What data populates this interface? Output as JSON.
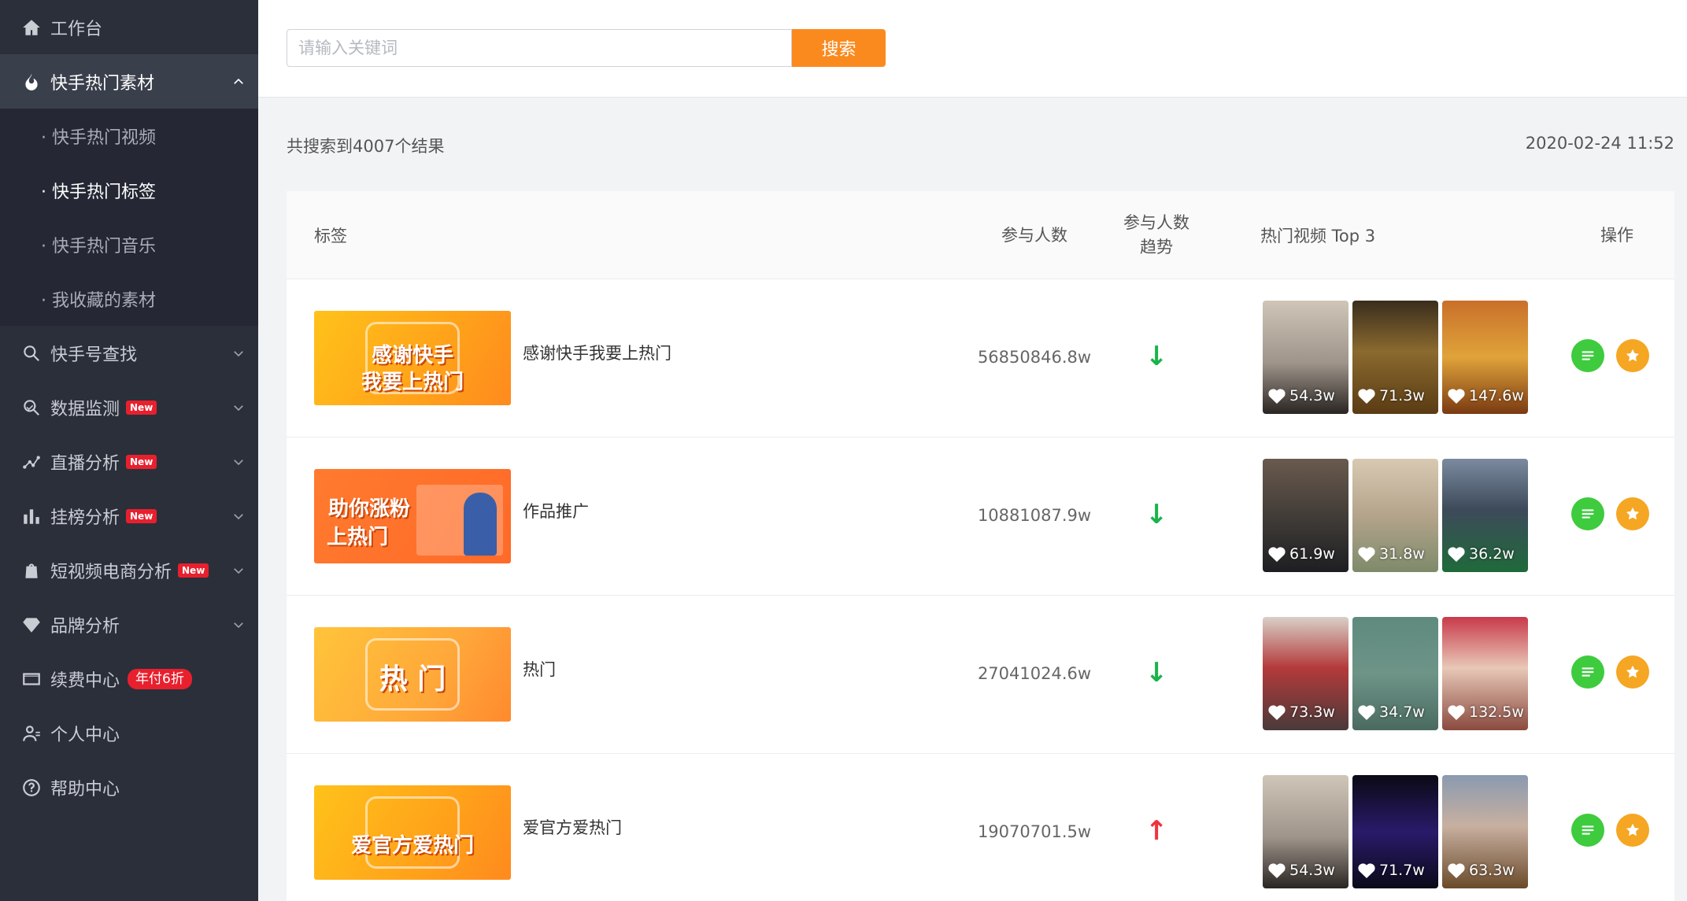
{
  "sidebar": {
    "items": [
      {
        "label": "工作台",
        "icon": "home-icon"
      },
      {
        "label": "快手热门素材",
        "icon": "fire-icon",
        "expanded": true,
        "children": [
          "· 快手热门视频",
          "· 快手热门标签",
          "· 快手热门音乐",
          "· 我收藏的素材"
        ],
        "current_child": 1
      },
      {
        "label": "快手号查找",
        "icon": "search-icon"
      },
      {
        "label": "数据监测",
        "icon": "monitor-icon",
        "badge": "New"
      },
      {
        "label": "直播分析",
        "icon": "live-chart-icon",
        "badge": "New"
      },
      {
        "label": "挂榜分析",
        "icon": "bar-chart-icon",
        "badge": "New"
      },
      {
        "label": "短视频电商分析",
        "icon": "shopping-bag-icon",
        "badge": "New"
      },
      {
        "label": "品牌分析",
        "icon": "diamond-icon"
      },
      {
        "label": "续费中心",
        "icon": "card-icon",
        "promo": "年付6折"
      },
      {
        "label": "个人中心",
        "icon": "user-icon"
      },
      {
        "label": "帮助中心",
        "icon": "help-icon"
      }
    ]
  },
  "search": {
    "placeholder": "请输入关键词",
    "value": "",
    "button_label": "搜索"
  },
  "results": {
    "count_text": "共搜索到4007个结果",
    "timestamp": "2020-02-24 11:52"
  },
  "table": {
    "headers": {
      "tag": "标签",
      "participants": "参与人数",
      "trend_line1": "参与人数",
      "trend_line2": "趋势",
      "top_videos": "热门视频 Top 3",
      "actions": "操作"
    },
    "rows": [
      {
        "thumb_lines": [
          "感谢快手",
          "我要上热门"
        ],
        "name": "感谢快手我要上热门",
        "participants": "56850846.8w",
        "trend": "down",
        "videos": [
          {
            "likes": "54.3w"
          },
          {
            "likes": "71.3w"
          },
          {
            "likes": "147.6w"
          }
        ]
      },
      {
        "thumb_lines": [
          "助你涨粉",
          "上热门"
        ],
        "name": "作品推广",
        "participants": "10881087.9w",
        "trend": "down",
        "videos": [
          {
            "likes": "61.9w"
          },
          {
            "likes": "31.8w"
          },
          {
            "likes": "36.2w"
          }
        ]
      },
      {
        "thumb_lines": [
          "热 门"
        ],
        "name": "热门",
        "participants": "27041024.6w",
        "trend": "down",
        "videos": [
          {
            "likes": "73.3w"
          },
          {
            "likes": "34.7w"
          },
          {
            "likes": "132.5w"
          }
        ]
      },
      {
        "thumb_lines": [
          "爱官方爱热门"
        ],
        "name": "爱官方爱热门",
        "participants": "19070701.5w",
        "trend": "up",
        "videos": [
          {
            "likes": "54.3w"
          },
          {
            "likes": "71.7w"
          },
          {
            "likes": "63.3w"
          }
        ]
      }
    ]
  },
  "colors": {
    "sidebar_bg": "#2b2f3a",
    "accent_orange": "#fb8a1e",
    "trend_down": "#19b34a",
    "trend_up": "#f0323c",
    "detail_btn": "#3ecb3e",
    "fav_btn": "#f5a623",
    "badge_red": "#e8202e"
  }
}
